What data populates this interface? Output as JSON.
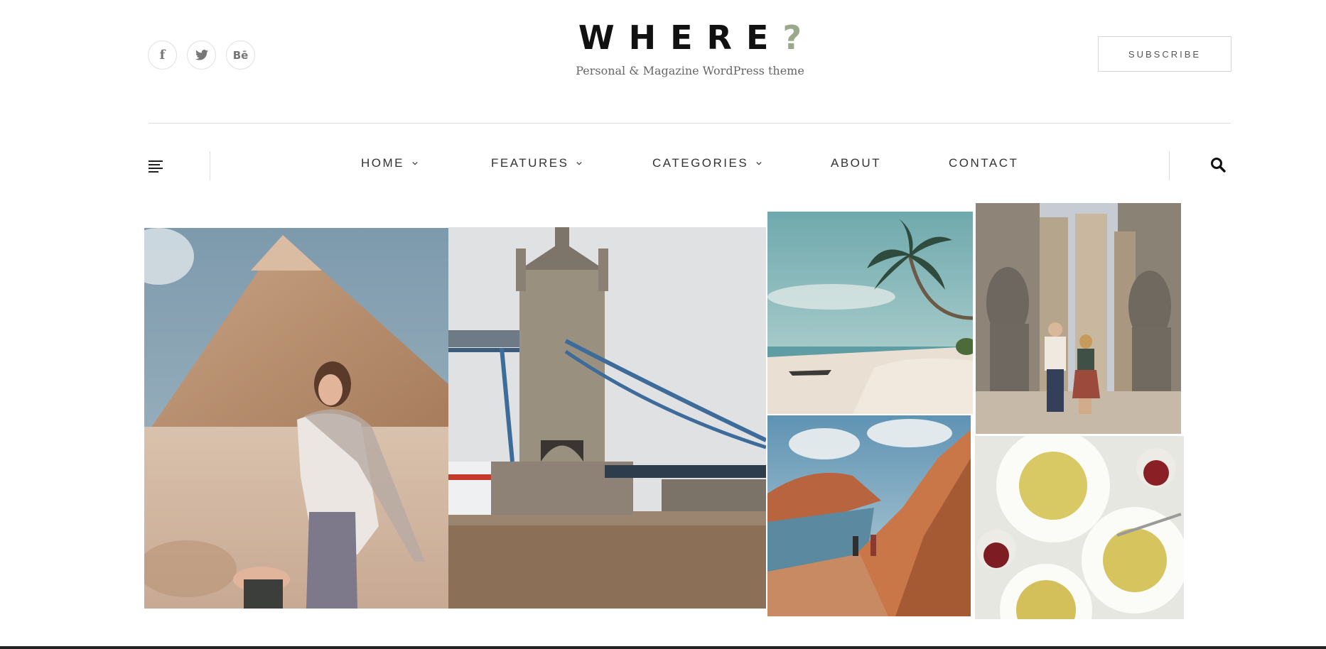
{
  "header": {
    "logo_text": "WHERE",
    "logo_mark": "?",
    "tagline": "Personal & Magazine WordPress theme",
    "subscribe_label": "SUBSCRIBE",
    "social": [
      {
        "name": "facebook-icon",
        "glyph": "f"
      },
      {
        "name": "twitter-icon",
        "glyph": ""
      },
      {
        "name": "behance-icon",
        "glyph": "Bē"
      }
    ]
  },
  "nav": {
    "items": [
      {
        "label": "HOME",
        "has_dropdown": true
      },
      {
        "label": "FEATURES",
        "has_dropdown": true
      },
      {
        "label": "CATEGORIES",
        "has_dropdown": true
      },
      {
        "label": "ABOUT",
        "has_dropdown": false
      },
      {
        "label": "CONTACT",
        "has_dropdown": false
      }
    ],
    "menu_icon": "hamburger-icon",
    "search_icon": "search-icon"
  },
  "gallery": {
    "photos": [
      {
        "name": "photo-pyramid",
        "subject": "woman at pyramid"
      },
      {
        "name": "photo-tower-bridge",
        "subject": "tower bridge"
      },
      {
        "name": "photo-palm-beach",
        "subject": "palm beach"
      },
      {
        "name": "photo-temple",
        "subject": "egyptian temple couple"
      },
      {
        "name": "photo-coast-cliffs",
        "subject": "coastal cliffs"
      },
      {
        "name": "photo-pasta",
        "subject": "pasta plates with wine"
      }
    ]
  },
  "colors": {
    "accent": "#9aa98c",
    "text": "#333333",
    "border": "#dcdcdc"
  }
}
